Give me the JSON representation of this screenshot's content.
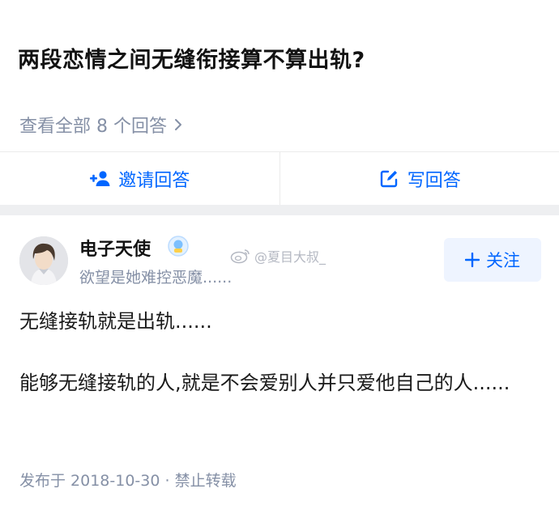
{
  "question": {
    "title": "两段恋情之间无缝衔接算不算出轨?",
    "view_all": "查看全部 8 个回答"
  },
  "actions": {
    "invite_label": "邀请回答",
    "write_label": "写回答"
  },
  "author": {
    "name": "电子天使",
    "bio": "欲望是她难控恶魔......",
    "follow_label": "关注"
  },
  "watermark": {
    "text": "@夏目大叔_"
  },
  "answer": {
    "paragraphs": [
      "无缝接轨就是出轨......",
      "能够无缝接轨的人,就是不会爱别人并只爱他自己的人......"
    ],
    "meta": "发布于 2018-10-30 · 禁止转载"
  },
  "colors": {
    "accent": "#0066ff",
    "muted": "#8590a6",
    "divider": "#eeeff1"
  },
  "icons": [
    "chevron-right-icon",
    "invite-user-icon",
    "edit-icon",
    "verified-badge-icon",
    "weibo-icon",
    "plus-icon"
  ]
}
